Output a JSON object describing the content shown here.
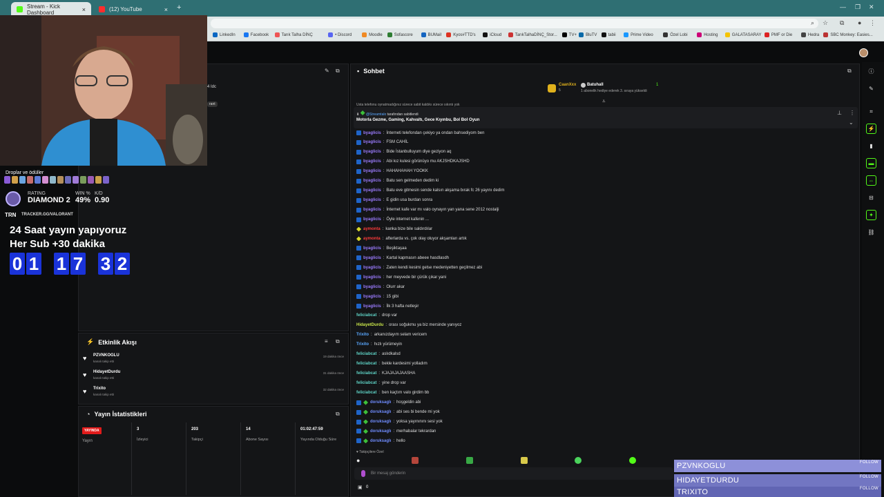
{
  "browser": {
    "tabs": [
      {
        "title": "Stream - Kick Dashboard",
        "favicon_color": "#53fc18"
      },
      {
        "title": "(12) YouTube",
        "favicon_color": "#ff2d2d"
      }
    ],
    "bookmarks": [
      "LinkedIn",
      "Facebook",
      "Tarık Talha DİNÇ",
      "• Discord",
      "Moodle",
      "Sofascore",
      "BUMail",
      "Kyos#TTD's",
      "iCloud",
      "TarıkTalhaDİNÇ_Stor...",
      "TV+",
      "BluTV",
      "tabii",
      "Prime Video",
      "Özel Lobi",
      "Hosting",
      "GALATASARAY",
      "PMF or Die",
      "Hedra",
      "SBC Monkey: Easies..."
    ]
  },
  "overlay": {
    "drops_label": "Droplar ve ödüller",
    "rating_label": "RATING",
    "rating_value": "DIAMOND 2",
    "win_label": "WIN %",
    "win_value": "49%",
    "kd_label": "K/D",
    "kd_value": "0.90",
    "tracker_logo": "TRN",
    "tracker_url": "TRACKER.GG/VALORANT",
    "line1": "24 Saat yayın yapıyoruz",
    "line2": "Her Sub +30 dakika",
    "timer_digits": [
      "0",
      "1",
      "1",
      "7",
      "3",
      "2"
    ]
  },
  "left_panel": {
    "partial_text_1": "4 Idc",
    "partial_text_2": "rant"
  },
  "chat": {
    "title": "Sohbet",
    "top_user_1": "CaanXxx",
    "top_user_1_count": "5",
    "top_user_2": "Batuhall",
    "top_user_2_count": "1",
    "top_subtitle": "1 abonelik hediye ederek 3. sıraya yükseldi",
    "pinned_partial": "Usta telefonu oynatmadığınız sürece sabit kaldıkı sürece sıkıntı yok",
    "pinned_by_user": "@Streamtalo",
    "pinned_by_suffix": "tarafından sabitlendi",
    "pinned_message": "Motorla Gezme, Gaming, Kahvaltı, Gece Kıyınbu, Bol Bol Oyun",
    "messages": [
      {
        "user": "byaglicis",
        "text": "İnterneti telefondan çekiyo ya ondan bahsediyom ben",
        "badge": "blue",
        "color": "#9b7bff"
      },
      {
        "user": "byaglicis",
        "text": "FSM CAHİL",
        "badge": "blue",
        "color": "#9b7bff"
      },
      {
        "user": "byaglicis",
        "text": "Bide İstanbulluyum diye geziyon aq",
        "badge": "blue",
        "color": "#9b7bff"
      },
      {
        "user": "byaglicis",
        "text": "Abi kız kulesi görünüyo mu AKJSHDKAJSHD",
        "badge": "blue",
        "color": "#9b7bff"
      },
      {
        "user": "byaglicis",
        "text": "HAHAHAHAH YOOKK",
        "badge": "blue",
        "color": "#9b7bff"
      },
      {
        "user": "byaglicis",
        "text": "Batu sen gelmeden dedim ki",
        "badge": "blue",
        "color": "#9b7bff"
      },
      {
        "user": "byaglicis",
        "text": "Batu eve gitmesin sende kalsın akşama bırak fc 26 yayını dedim",
        "badge": "blue",
        "color": "#9b7bff"
      },
      {
        "user": "byaglicis",
        "text": "E gidin usa burdan sonra",
        "badge": "blue",
        "color": "#9b7bff"
      },
      {
        "user": "byaglicis",
        "text": "İnternet kafe var mı valo oynayın yan yana sene 2012 nostalji",
        "badge": "blue",
        "color": "#9b7bff"
      },
      {
        "user": "byaglicis",
        "text": "Öyle internet kafenin ...",
        "badge": "blue",
        "color": "#9b7bff"
      },
      {
        "user": "aymonta",
        "text": "kanka bize bile saldırdılar",
        "badge": "yellow",
        "color": "#ff3b3b"
      },
      {
        "user": "aymonta",
        "text": "afterlarda vs. çok olay oluyor akşamları artık",
        "badge": "yellow",
        "color": "#ff3b3b"
      },
      {
        "user": "byaglicis",
        "text": "Beşiktaşaa",
        "badge": "blue",
        "color": "#9b7bff"
      },
      {
        "user": "byaglicis",
        "text": "Kartal kapmasın abeee hasdlasdh",
        "badge": "blue",
        "color": "#9b7bff"
      },
      {
        "user": "byaglicis",
        "text": "Zaten kendi kesimi gelse medeniyetten geçilmez abi",
        "badge": "blue",
        "color": "#9b7bff"
      },
      {
        "user": "byaglicis",
        "text": "her meyvede bir çürük çıkar yani",
        "badge": "blue",
        "color": "#9b7bff"
      },
      {
        "user": "byaglicis",
        "text": "Olurr akar",
        "badge": "blue",
        "color": "#9b7bff"
      },
      {
        "user": "byaglicis",
        "text": "15 gibi",
        "badge": "blue",
        "color": "#9b7bff"
      },
      {
        "user": "byaglicis",
        "text": "İlk 3 hafta netleşir",
        "badge": "blue",
        "color": "#9b7bff"
      },
      {
        "user": "feliciabcat",
        "text": "drop var",
        "badge": "none",
        "color": "#5fd3c6"
      },
      {
        "user": "HidayetDurdu",
        "text": "orası soğukmu ya biz mersinde yanıyoz",
        "badge": "none",
        "color": "#c9e64a"
      },
      {
        "user": "Trixito",
        "text": "arkanızdayım selam vericem",
        "badge": "none",
        "color": "#5aa8ff"
      },
      {
        "user": "Trixito",
        "text": "hızlı yürümeyin",
        "badge": "none",
        "color": "#5aa8ff"
      },
      {
        "user": "feliciabcat",
        "text": "aslıdkalsd",
        "badge": "none",
        "color": "#5fd3c6"
      },
      {
        "user": "feliciabcat",
        "text": "bekle kardesimi yolladım",
        "badge": "none",
        "color": "#5fd3c6"
      },
      {
        "user": "feliciabcat",
        "text": "KJAJAJAJAASHA",
        "badge": "none",
        "color": "#5fd3c6"
      },
      {
        "user": "feliciabcat",
        "text": "yine drop var",
        "badge": "none",
        "color": "#5fd3c6"
      },
      {
        "user": "feliciabcat",
        "text": "ben kaçtım valo girdim bb",
        "badge": "none",
        "color": "#5fd3c6"
      },
      {
        "user": "doruksaglı",
        "text": "hoşgeldin abi",
        "badge": "bluegreen",
        "color": "#6f8cff"
      },
      {
        "user": "doruksaglı",
        "text": "abi ses bi bende mi yok",
        "badge": "bluegreen",
        "color": "#6f8cff"
      },
      {
        "user": "doruksaglı",
        "text": "yoksa yayınınını sesi yok",
        "badge": "bluegreen",
        "color": "#6f8cff"
      },
      {
        "user": "doruksaglı",
        "text": "merhabalar tekrardan",
        "badge": "bluegreen",
        "color": "#6f8cff"
      },
      {
        "user": "doruksaglı",
        "text": "hello",
        "badge": "bluegreen",
        "color": "#6f8cff"
      }
    ],
    "followers_only_label": "Takipçilere Özel",
    "input_placeholder": "Bir mesaj gönderin",
    "points_value": "0"
  },
  "activity": {
    "title": "Etkinlik Akışı",
    "items": [
      {
        "user": "PZVNKOGLU",
        "action": "kanalı takip etti",
        "time": "19 dakika önce"
      },
      {
        "user": "HidayetDurdu",
        "action": "kanalı takip etti",
        "time": "31 dakika önce"
      },
      {
        "user": "Trixito",
        "action": "kanalı takip etti",
        "time": "32 dakika önce"
      }
    ]
  },
  "stats": {
    "title": "Yayın İstatistikleri",
    "live_badge": "YAYINDA",
    "columns": [
      {
        "value": "",
        "label": "Yayın"
      },
      {
        "value": "3",
        "label": "İzleyici"
      },
      {
        "value": "203",
        "label": "Takipçi"
      },
      {
        "value": "14",
        "label": "Abone Sayısı"
      },
      {
        "value": "01:02:47:59",
        "label": "Yayında Olduğu Süre"
      }
    ]
  },
  "follow_popup": {
    "names": [
      "PZVNKOGLU",
      "HIDAYETDURDU",
      "TRIXITO"
    ],
    "follow_label": "FOLLOW"
  },
  "colors": {
    "accent": "#53fc18",
    "timer_bg": "#1a33d9",
    "popup_bg": "#7b7fc9",
    "chrome_teal": "#2f6f73"
  }
}
